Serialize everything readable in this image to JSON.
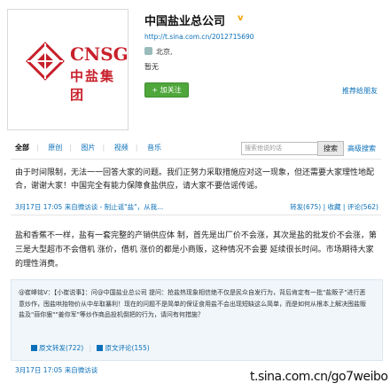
{
  "profile": {
    "logo_text_en": "CNSG",
    "logo_text_cn": "中盐集团",
    "name": "中国盐业总公司",
    "verified_badge": "v",
    "url": "http://t.sina.com.cn/2012715690",
    "location": "北京,",
    "bio": "暂无",
    "follow_label": "+ 加关注",
    "recommend_label": "推荐给朋友"
  },
  "tabs": [
    {
      "label": "全部"
    },
    {
      "label": "原创"
    },
    {
      "label": "图片"
    },
    {
      "label": "视频"
    },
    {
      "label": "音乐"
    }
  ],
  "search": {
    "placeholder": "搜索他说的话",
    "button_label": "搜索",
    "advanced_label": "高级搜索"
  },
  "posts": [
    {
      "text": "由于时间限制，无法一一回答大家的问题。我们正努力采取措施应对这一现象，但还需要大家理性地配合，谢谢大家！中国完全有能力保障食盐供应，请大家不要信谣传谣。",
      "meta_left": "3月17日 17:05  来自微访谈 - 制止谣\"盐\"，从我...",
      "meta_right": "转发(675)  |  收藏  |  评论(562)"
    },
    {
      "text": "盐和香蕉不一样，盐有一套完整的产销供应体 制，首先是出厂价不会涨，其次是盐的批发价不会涨，第三是大型超市不会借机 涨价，借机 涨价的都是小商贩，这种情况不会要 延续很长时间。市场期待大家的理性消费。",
      "quote": {
        "text": "@崔峰铭V：【小崔说事】：问@中国盐业总公司 提问：抢盐热现象相信绝不仅是民众自发行为，背后肯定有一批\"盐贩子\"进行恶意炒作，囤盐哄抬物价从中牟取暴利！现在的问题不是简单的保证食用盐不会出现短缺这么简单，而是如何从根本上解决囤盐贩盐及\"蒜你狠\"\"姜你军\"等炒作商品投机倒把的行为，请问有何措施？",
        "forward_label": "原文转发(722)",
        "comment_label": "原文评论(155)"
      },
      "meta_left": "3月17日 17:05  来自微访谈"
    }
  ],
  "watermark": "t.sina.com.cn/go7weibo",
  "colors": {
    "brand_red": "#c8202b",
    "link_blue": "#0a6fb8",
    "follow_green": "#4fa73b"
  }
}
